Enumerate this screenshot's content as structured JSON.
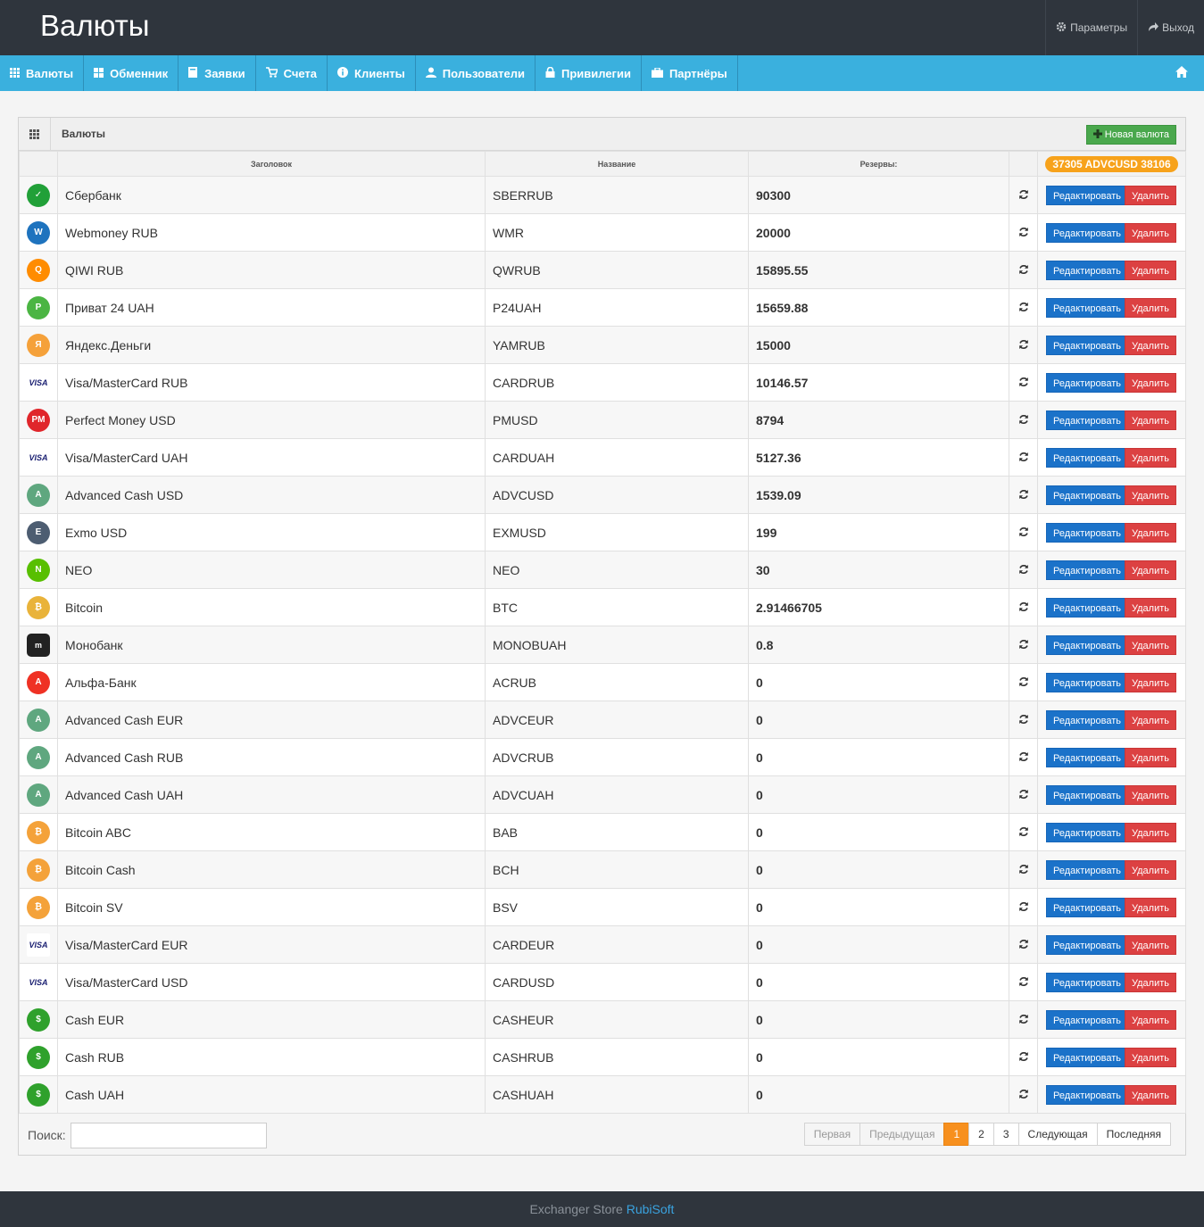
{
  "header": {
    "title": "Валюты",
    "links": [
      {
        "label": "Параметры",
        "icon": "gear-icon"
      },
      {
        "label": "Выход",
        "icon": "share-arrow-icon"
      }
    ]
  },
  "nav": {
    "items": [
      {
        "label": "Валюты",
        "icon": "grid-icon"
      },
      {
        "label": "Обменник",
        "icon": "windows-icon"
      },
      {
        "label": "Заявки",
        "icon": "book-icon"
      },
      {
        "label": "Счета",
        "icon": "cart-icon"
      },
      {
        "label": "Клиенты",
        "icon": "info-icon"
      },
      {
        "label": "Пользователи",
        "icon": "user-icon"
      },
      {
        "label": "Привилегии",
        "icon": "lock-icon"
      },
      {
        "label": "Партнёры",
        "icon": "briefcase-icon"
      }
    ],
    "home_icon": "home-icon"
  },
  "panel": {
    "title": "Валюты",
    "new_button": "Новая валюта",
    "reserve_total": "37305 ADVCUSD 38106",
    "columns": {
      "title": "Заголовок",
      "name": "Название",
      "reserves": "Резервы:"
    },
    "edit_label": "Редактировать",
    "delete_label": "Удалить",
    "rows": [
      {
        "title": "Сбербанк",
        "code": "SBERRUB",
        "reserve": "90300",
        "icon": "sberbank-icon",
        "color": "#21a038"
      },
      {
        "title": "Webmoney RUB",
        "code": "WMR",
        "reserve": "20000",
        "icon": "webmoney-icon",
        "color": "#1e73be"
      },
      {
        "title": "QIWI RUB",
        "code": "QWRUB",
        "reserve": "15895.55",
        "icon": "qiwi-icon",
        "color": "#ff8c00"
      },
      {
        "title": "Приват 24 UAH",
        "code": "P24UAH",
        "reserve": "15659.88",
        "icon": "privat24-icon",
        "color": "#4bb543"
      },
      {
        "title": "Яндекс.Деньги",
        "code": "YAMRUB",
        "reserve": "15000",
        "icon": "yandex-money-icon",
        "color": "#f5a13a"
      },
      {
        "title": "Visa/MasterCard RUB",
        "code": "CARDRUB",
        "reserve": "10146.57",
        "icon": "visa-mastercard-icon",
        "color": "#1a1f71"
      },
      {
        "title": "Perfect Money USD",
        "code": "PMUSD",
        "reserve": "8794",
        "icon": "perfect-money-icon",
        "color": "#e0262b"
      },
      {
        "title": "Visa/MasterCard UAH",
        "code": "CARDUAH",
        "reserve": "5127.36",
        "icon": "visa-mastercard-icon",
        "color": "#1a1f71"
      },
      {
        "title": "Advanced Cash USD",
        "code": "ADVCUSD",
        "reserve": "1539.09",
        "icon": "advcash-icon",
        "color": "#5fa77f"
      },
      {
        "title": "Exmo USD",
        "code": "EXMUSD",
        "reserve": "199",
        "icon": "exmo-icon",
        "color": "#4d5d71"
      },
      {
        "title": "NEO",
        "code": "NEO",
        "reserve": "30",
        "icon": "neo-icon",
        "color": "#58bf00"
      },
      {
        "title": "Bitcoin",
        "code": "BTC",
        "reserve": "2.91466705",
        "icon": "bitcoin-icon",
        "color": "#e9b33a"
      },
      {
        "title": "Монобанк",
        "code": "MONOBUAH",
        "reserve": "0.8",
        "icon": "monobank-icon",
        "color": "#222222"
      },
      {
        "title": "Альфа-Банк",
        "code": "ACRUB",
        "reserve": "0",
        "icon": "alfa-bank-icon",
        "color": "#ef3124"
      },
      {
        "title": "Advanced Cash EUR",
        "code": "ADVCEUR",
        "reserve": "0",
        "icon": "advcash-icon",
        "color": "#5fa77f"
      },
      {
        "title": "Advanced Cash RUB",
        "code": "ADVCRUB",
        "reserve": "0",
        "icon": "advcash-icon",
        "color": "#5fa77f"
      },
      {
        "title": "Advanced Cash UAH",
        "code": "ADVCUAH",
        "reserve": "0",
        "icon": "advcash-icon",
        "color": "#5fa77f"
      },
      {
        "title": "Bitcoin ABC",
        "code": "BAB",
        "reserve": "0",
        "icon": "bitcoin-icon",
        "color": "#f4a23a"
      },
      {
        "title": "Bitcoin Cash",
        "code": "BCH",
        "reserve": "0",
        "icon": "bitcoin-icon",
        "color": "#f4a23a"
      },
      {
        "title": "Bitcoin SV",
        "code": "BSV",
        "reserve": "0",
        "icon": "bitcoin-icon",
        "color": "#f4a23a"
      },
      {
        "title": "Visa/MasterCard EUR",
        "code": "CARDEUR",
        "reserve": "0",
        "icon": "visa-mastercard-icon",
        "color": "#1a1f71"
      },
      {
        "title": "Visa/MasterCard USD",
        "code": "CARDUSD",
        "reserve": "0",
        "icon": "visa-mastercard-icon",
        "color": "#1a1f71"
      },
      {
        "title": "Cash EUR",
        "code": "CASHEUR",
        "reserve": "0",
        "icon": "cash-dollar-icon",
        "color": "#2fa12c"
      },
      {
        "title": "Cash RUB",
        "code": "CASHRUB",
        "reserve": "0",
        "icon": "cash-dollar-icon",
        "color": "#2fa12c"
      },
      {
        "title": "Cash UAH",
        "code": "CASHUAH",
        "reserve": "0",
        "icon": "cash-dollar-icon",
        "color": "#2fa12c"
      }
    ]
  },
  "search": {
    "label": "Поиск:",
    "value": "",
    "placeholder": ""
  },
  "pagination": {
    "first": "Первая",
    "prev": "Предыдущая",
    "pages": [
      "1",
      "2",
      "3"
    ],
    "current": "1",
    "next": "Следующая",
    "last": "Последняя"
  },
  "footer": {
    "text": "Exchanger Store",
    "brand": "RubiSoft"
  }
}
